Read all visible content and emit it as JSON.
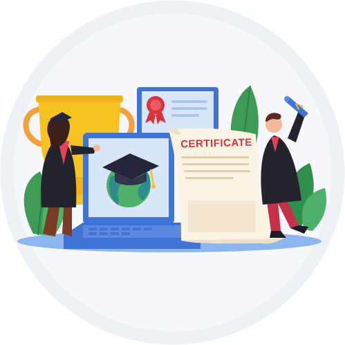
{
  "certificate": {
    "title": "CERTIFICATE"
  },
  "colors": {
    "circle_bg": "#eef1f6",
    "trophy_gold": "#f6c21f",
    "trophy_handle": "#f3a03b",
    "leaf_green": "#3d9b56",
    "laptop_blue": "#3f74d6",
    "screen_light": "#d9e6f8",
    "platform_blue": "#8db6ef",
    "cert_paper": "#fbf3e6",
    "cert_red": "#d8323c",
    "gown_dark": "#23232d"
  },
  "icons": [
    "trophy-icon",
    "award-ribbon-icon",
    "graduation-cap-icon",
    "globe-icon",
    "laptop-icon",
    "diploma-scroll-icon",
    "leaf-plant-icon"
  ]
}
